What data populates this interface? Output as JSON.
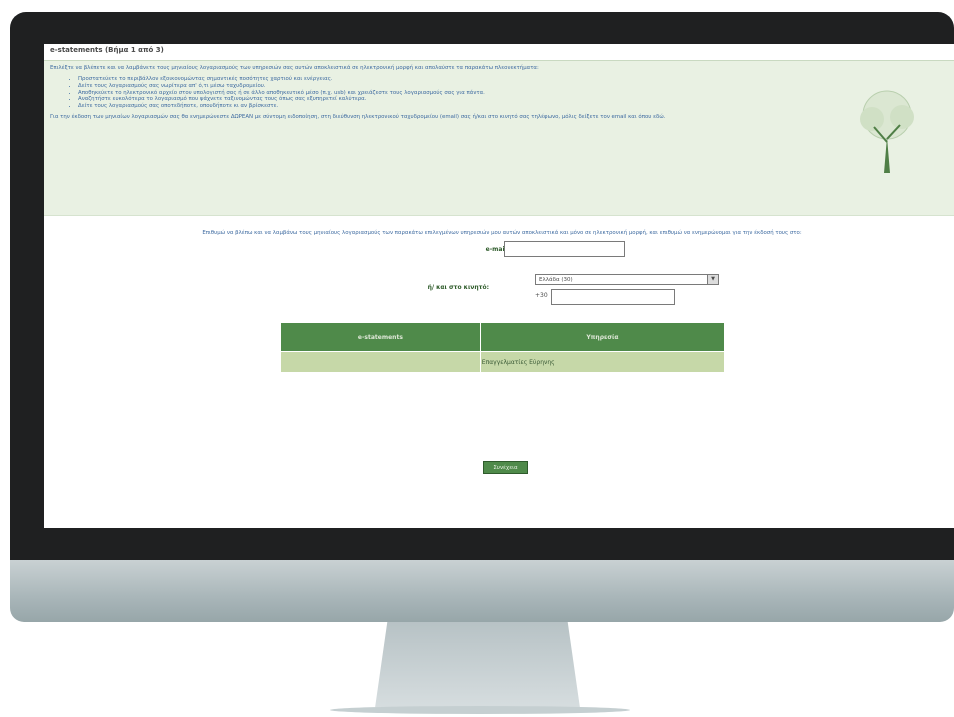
{
  "page": {
    "title": "e-statements (Βήμα 1 από 3)"
  },
  "intro": {
    "paragraph1": "Επιλέξτε να βλέπετε και να λαμβάνετε τους μηνιαίους λογαριασμούς των υπηρεσιών σας αυτών αποκλειστικά σε ηλεκτρονική μορφή και απολαύστε τα παρακάτω πλεονεκτήματα:",
    "bullets": [
      "Προστατεύετε το περιβάλλον εξοικονομώντας σημαντικές ποσότητες χαρτιού και ενέργειας.",
      "Δείτε τους λογαριασμούς σας νωρίτερα απ' ό,τι μέσω ταχυδρομείου.",
      "Αποθηκεύετε το ηλεκτρονικό αρχείο στον υπολογιστή σας ή σε άλλο αποθηκευτικό μέσο (π.χ. usb) και χρειάζεστε τους λογαριασμούς σας για πάντα.",
      "Αναζητήστε ευκολότερα το λογαριασμό που ψάχνετε ταξινομώντας τους όπως σας εξυπηρετεί καλύτερα.",
      "Δείτε τους λογαριασμούς σας οποτεδήποτε, οπουδήποτε κι αν βρίσκεστε."
    ],
    "paragraph2": "Για την έκδοση των μηνιαίων λογαριασμών σας θα ενημερώνεστε ΔΩΡΕΑΝ με σύντομη ειδοποίηση, στη διεύθυνση ηλεκτρονικού ταχυδρομείου (email) σας ή/και στο κινητό σας τηλέφωνο, μόλις δείξετε τον email και όπου εδώ."
  },
  "form": {
    "help_text": "Επιθυμώ να βλέπω και να λαμβάνω τους μηνιαίους λογαριασμούς των παρακάτω επιλεγμένων υπηρεσιών μου αυτών αποκλειστικά και μόνο σε ηλεκτρονική μορφή, και επιθυμώ να ενημερώνομαι για την έκδοσή τους στο:",
    "email_label": "e-mail:",
    "email_value": "",
    "mobile_label": "ή/ και στο κινητό:",
    "country_select": "Ελλάδα (30)",
    "phone_prefix": "+30",
    "phone_value": ""
  },
  "services_table": {
    "headers": [
      "e-statements",
      "Υπηρεσία"
    ],
    "rows": [
      [
        "",
        "Επαγγελματίες Εύρηνης"
      ]
    ]
  },
  "submit_label": "Συνέχεια",
  "colors": {
    "accent": "#4f8a4a",
    "row": "#c6d8a8",
    "intro_bg": "#e9f1e3"
  }
}
